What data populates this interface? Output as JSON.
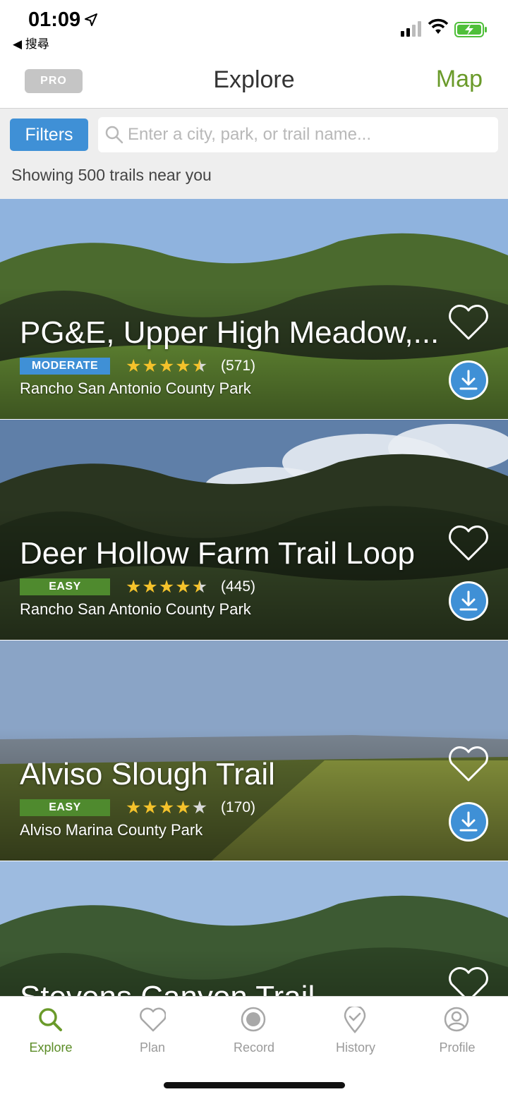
{
  "status_bar": {
    "time": "01:09",
    "back_app": "◀ 搜尋"
  },
  "nav": {
    "pro_label": "PRO",
    "title": "Explore",
    "map_label": "Map"
  },
  "search": {
    "filters_label": "Filters",
    "placeholder": "Enter a city, park, or trail name...",
    "value": "",
    "result_text": "Showing 500 trails near you"
  },
  "trails": [
    {
      "name": "PG&E, Upper High Meadow,...",
      "difficulty": "MODERATE",
      "rating": 4.5,
      "reviews": "(571)",
      "park": "Rancho San Antonio County Park",
      "colors": {
        "sky": "#8fb3de",
        "hills": "#4b6a2e",
        "trees": "#2e3d22",
        "ground": "#6f9a3a"
      }
    },
    {
      "name": "Deer Hollow Farm Trail Loop",
      "difficulty": "EASY",
      "rating": 4.5,
      "reviews": "(445)",
      "park": "Rancho San Antonio County Park",
      "colors": {
        "sky": "#5f7fa8",
        "hills": "#2a3520",
        "trees": "#1f2a18",
        "ground": "#3b4d2a"
      }
    },
    {
      "name": "Alviso Slough Trail",
      "difficulty": "EASY",
      "rating": 4,
      "reviews": "(170)",
      "park": "Alviso Marina County Park",
      "colors": {
        "sky": "#8aa4c6",
        "hills": "#7a8591",
        "trees": "#5c6b2e",
        "ground": "#8d9a3f"
      }
    },
    {
      "name": "Stevens Canyon Trail",
      "difficulty": "",
      "rating": 0,
      "reviews": "",
      "park": "",
      "colors": {
        "sky": "#9dbbe0",
        "hills": "#3d5a33",
        "trees": "#2d4425",
        "ground": "#5c7a3a"
      }
    }
  ],
  "tabs": [
    {
      "label": "Explore",
      "icon": "search-icon",
      "active": true
    },
    {
      "label": "Plan",
      "icon": "heart-icon",
      "active": false
    },
    {
      "label": "Record",
      "icon": "record-icon",
      "active": false
    },
    {
      "label": "History",
      "icon": "location-check-icon",
      "active": false
    },
    {
      "label": "Profile",
      "icon": "profile-icon",
      "active": false
    }
  ],
  "colors": {
    "accent_green": "#6a9a2a",
    "accent_blue": "#3f90d6",
    "easy_green": "#4f8a2e",
    "star_yellow": "#f4c22b"
  }
}
